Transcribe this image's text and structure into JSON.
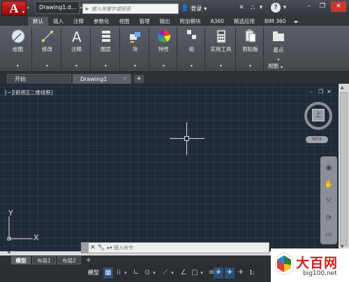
{
  "titlebar": {
    "app_letter": "A",
    "document_title": "Drawing1.d...",
    "search_placeholder": "键入关键字或短语",
    "account_label": "登录",
    "help_label": "?"
  },
  "ribbon_tabs": [
    "默认",
    "插入",
    "注释",
    "参数化",
    "视图",
    "管理",
    "输出",
    "附加模块",
    "A360",
    "精选应用",
    "BIM 360"
  ],
  "ribbon_active_tab": "默认",
  "panels": {
    "draw": "绘图",
    "modify": "修改",
    "annotate": "注释",
    "layers": "图层",
    "block": "块",
    "properties": "特性",
    "groups": "组",
    "utilities": "实用工具",
    "clipboard": "剪贴板",
    "base": "基点",
    "view_footer": "视图"
  },
  "file_tabs": {
    "start": "开始",
    "drawing": "Drawing1",
    "new_tab": "+"
  },
  "viewport": {
    "label": "[−][俯视][二维线框]",
    "viewcube_face": "上",
    "wcs": "WCS",
    "ucs_x": "X",
    "ucs_y": "Y"
  },
  "command_line": {
    "placeholder": "键入命令"
  },
  "layout_tabs": [
    "模型",
    "布局1",
    "布局2"
  ],
  "statusbar": {
    "model_label": "模型",
    "scale_text": "1:"
  },
  "watermark": {
    "title": "大百网",
    "url": "big100.net"
  },
  "colors": {
    "app_logo_red": "#c81f1f",
    "canvas_bg": "#212a38",
    "accent_blue": "#2e4f7a"
  }
}
